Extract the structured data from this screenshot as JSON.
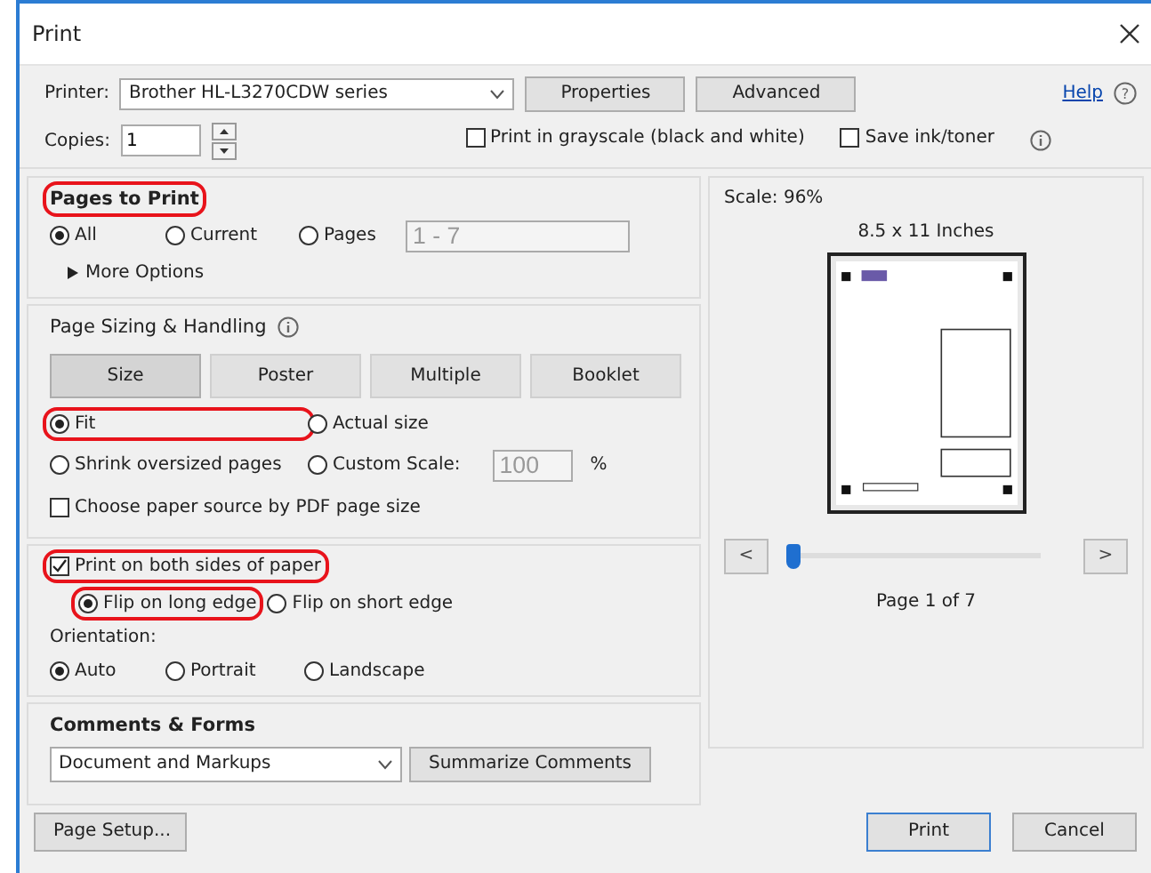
{
  "window": {
    "title": "Print"
  },
  "printer": {
    "label": "Printer:",
    "value": "Brother HL-L3270CDW series",
    "buttons": [
      "Properties",
      "Advanced"
    ]
  },
  "help": {
    "link": "Help",
    "icon": "?"
  },
  "copies": {
    "label": "Copies:",
    "value": "1"
  },
  "options": [
    {
      "label": "Print in grayscale (black and white)",
      "checked": false
    },
    {
      "label": "Save ink/toner",
      "checked": false
    }
  ],
  "pages_to_print": {
    "title": "Pages to Print",
    "highlighted": true,
    "radios": [
      {
        "label": "All",
        "selected": true
      },
      {
        "label": "Current",
        "selected": false
      },
      {
        "label": "Pages",
        "selected": false
      }
    ],
    "range": {
      "value": "1 - 7",
      "disabled": true
    },
    "more_options": {
      "label": "More Options",
      "expanded": false
    }
  },
  "page_sizing": {
    "title": "Page Sizing & Handling",
    "tabs": [
      {
        "label": "Size",
        "selected": true
      },
      {
        "label": "Poster",
        "selected": false
      },
      {
        "label": "Multiple",
        "selected": false
      },
      {
        "label": "Booklet",
        "selected": false
      }
    ],
    "radios": [
      {
        "label": "Fit",
        "selected": true,
        "highlighted": true
      },
      {
        "label": "Actual size",
        "selected": false
      },
      {
        "label": "Shrink oversized pages",
        "selected": false
      },
      {
        "label": "Custom Scale:",
        "selected": false
      }
    ],
    "custom_scale": {
      "value": "100",
      "unit": "%",
      "disabled": true
    },
    "paper_source": {
      "label": "Choose paper source by PDF page size",
      "checked": false
    }
  },
  "duplex": {
    "label": "Print on both sides of paper",
    "checked": true,
    "highlighted": true,
    "radios": [
      {
        "label": "Flip on long edge",
        "selected": true,
        "highlighted": true
      },
      {
        "label": "Flip on short edge",
        "selected": false
      }
    ]
  },
  "orientation": {
    "label": "Orientation:",
    "radios": [
      {
        "label": "Auto",
        "selected": true
      },
      {
        "label": "Portrait",
        "selected": false
      },
      {
        "label": "Landscape",
        "selected": false
      }
    ]
  },
  "comments_forms": {
    "title": "Comments & Forms",
    "value": "Document and Markups",
    "button": "Summarize Comments"
  },
  "preview": {
    "scale": "Scale:  96%",
    "paper": "8.5 x 11 Inches",
    "prev": "<",
    "next": ">",
    "level": 0,
    "page": "Page 1 of 7"
  },
  "footer": {
    "page_setup": "Page Setup...",
    "print": "Print",
    "cancel": "Cancel"
  }
}
